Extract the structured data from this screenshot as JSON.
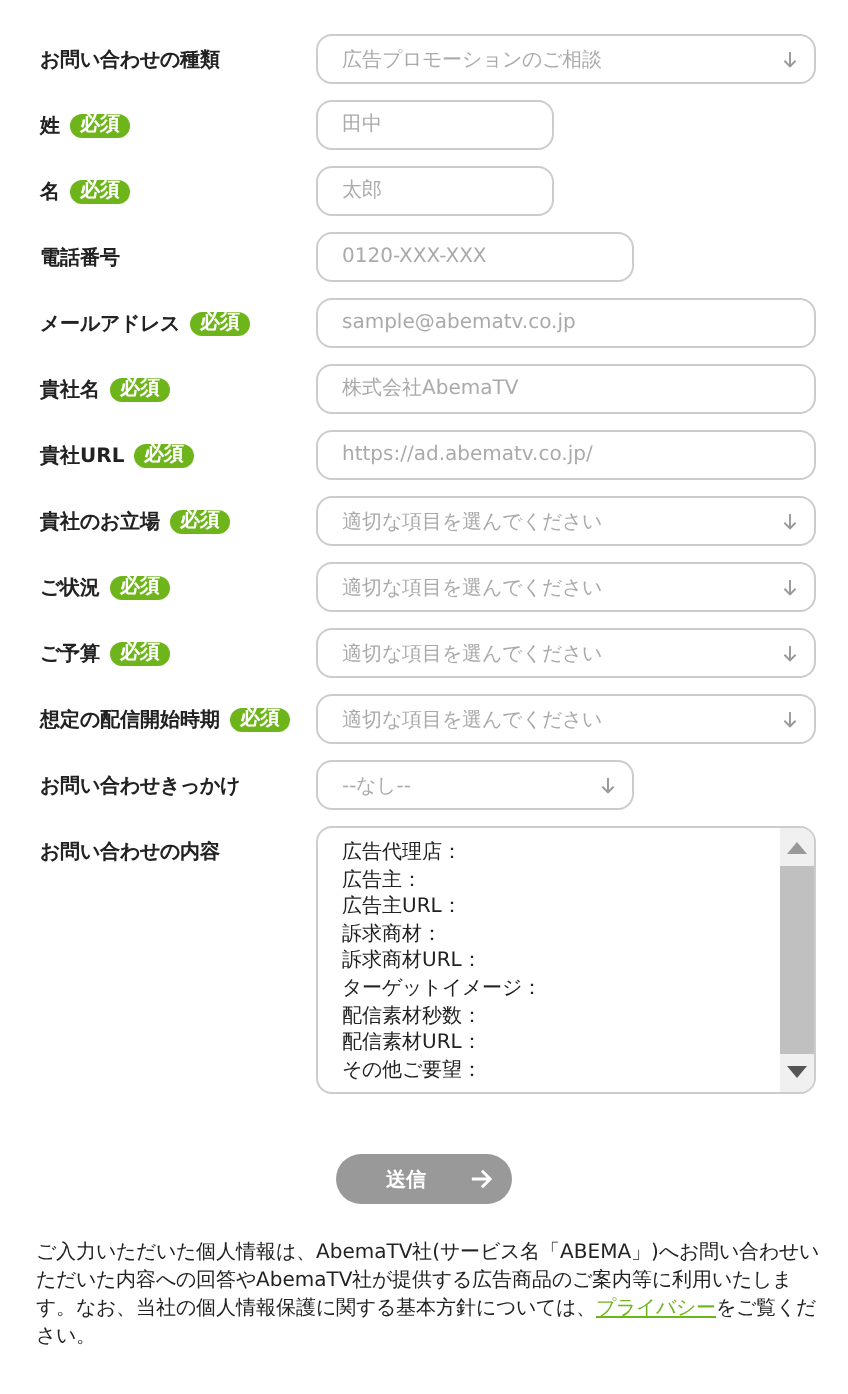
{
  "fields": [
    {
      "label": "お問い合わせの種類",
      "kind": "select",
      "value": "広告プロモーションのご相談"
    },
    {
      "label": "姓",
      "badge": "必須",
      "kind": "text",
      "placeholder": "田中"
    },
    {
      "label": "名",
      "badge": "必須",
      "kind": "text",
      "placeholder": "太郎"
    },
    {
      "label": "電話番号",
      "kind": "text",
      "placeholder": "0120-XXX-XXX"
    },
    {
      "label": "メールアドレス",
      "badge": "必須",
      "kind": "text",
      "placeholder": "sample@abematv.co.jp"
    },
    {
      "label": "貴社名",
      "badge": "必須",
      "kind": "text",
      "placeholder": "株式会社AbemaTV"
    },
    {
      "label": "貴社URL",
      "badge": "必須",
      "kind": "text",
      "placeholder": "https://ad.abematv.co.jp/"
    },
    {
      "label": "貴社のお立場",
      "badge": "必須",
      "kind": "select",
      "value": "適切な項目を選んでください"
    },
    {
      "label": "ご状況",
      "badge": "必須",
      "kind": "select",
      "value": "適切な項目を選んでください"
    },
    {
      "label": "ご予算",
      "badge": "必須",
      "kind": "select",
      "value": "適切な項目を選んでください"
    },
    {
      "label": "想定の配信開始時期",
      "badge": "必須",
      "kind": "select",
      "value": "適切な項目を選んでください"
    },
    {
      "label": "お問い合わせきっかけ",
      "kind": "select",
      "value": "--なし--"
    }
  ],
  "message": {
    "label": "お問い合わせの内容",
    "value": [
      "広告代理店：",
      "広告主：",
      "広告主URL：",
      "訴求商材：",
      "訴求商材URL：",
      "ターゲットイメージ：",
      "配信素材秒数：",
      "配信素材URL：",
      "その他ご要望："
    ]
  },
  "submit": {
    "label": "送信",
    "disabled": true
  },
  "notice": {
    "before": "ご入力いただいた個人情報は、AbemaTV社(サービス名「ABEMA」)へお問い合わせいただいた内容への回答やAbemaTV社が提供する広告商品のご案内等に利用いたします。なお、当社の個人情報保護に関する基本方針については、",
    "link": "プライバシー",
    "after": "をご覧ください。"
  }
}
